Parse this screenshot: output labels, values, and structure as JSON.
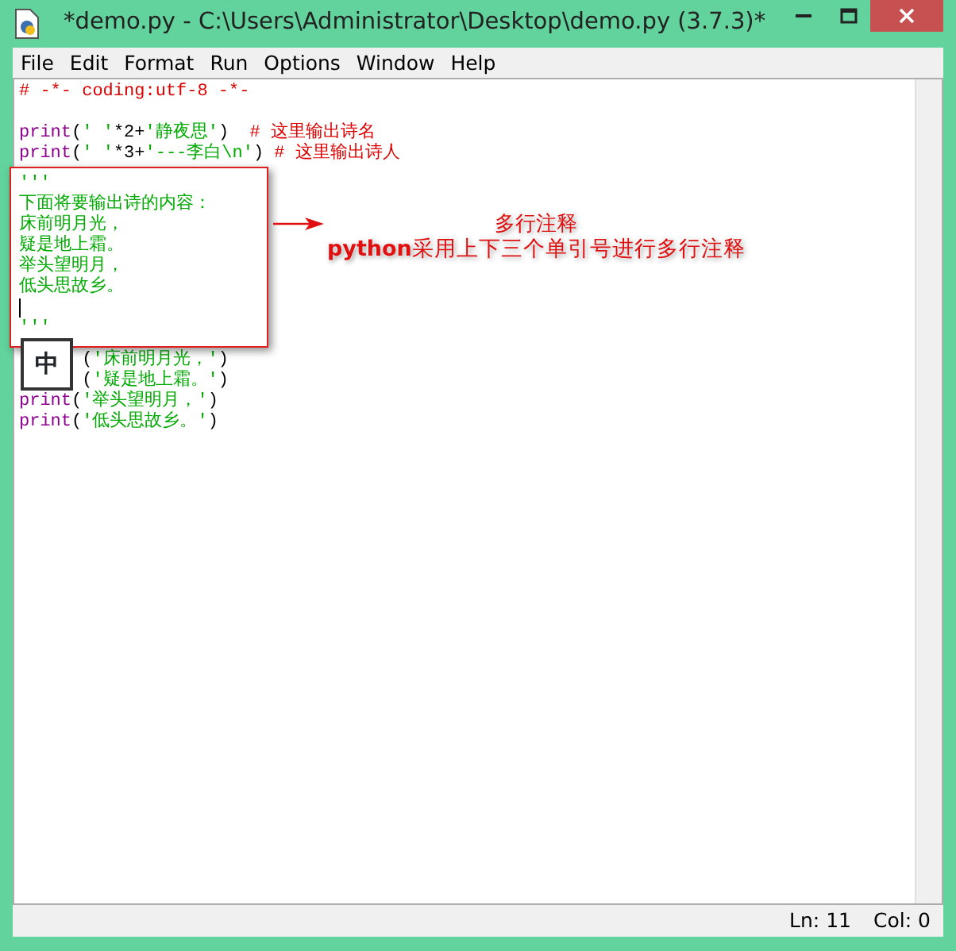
{
  "window": {
    "title": "*demo.py - C:\\Users\\Administrator\\Desktop\\demo.py (3.7.3)*"
  },
  "menu": [
    "File",
    "Edit",
    "Format",
    "Run",
    "Options",
    "Window",
    "Help"
  ],
  "code_lines": [
    {
      "segments": [
        {
          "kind": "comment",
          "text": "# -*- coding:utf-8 -*-"
        }
      ]
    },
    {
      "segments": [
        {
          "kind": "keyword",
          "text": "print"
        },
        {
          "kind": "plain",
          "text": "("
        },
        {
          "kind": "string",
          "text": "' '"
        },
        {
          "kind": "plain",
          "text": "*2+"
        },
        {
          "kind": "string",
          "text": "'静夜思'"
        },
        {
          "kind": "plain",
          "text": ")  "
        },
        {
          "kind": "comment",
          "text": "# 这里输出诗名"
        }
      ]
    },
    {
      "segments": [
        {
          "kind": "keyword",
          "text": "print"
        },
        {
          "kind": "plain",
          "text": "("
        },
        {
          "kind": "string",
          "text": "' '"
        },
        {
          "kind": "plain",
          "text": "*3+"
        },
        {
          "kind": "string",
          "text": "'---李白\\n'"
        },
        {
          "kind": "plain",
          "text": ") "
        },
        {
          "kind": "comment",
          "text": "# 这里输出诗人"
        }
      ]
    }
  ],
  "callout": {
    "lines": [
      {
        "kind": "text",
        "text": "'''"
      },
      {
        "kind": "text",
        "text": "下面将要输出诗的内容："
      },
      {
        "kind": "text",
        "text": "床前明月光，"
      },
      {
        "kind": "text",
        "text": "疑是地上霜。"
      },
      {
        "kind": "text",
        "text": "举头望明月，"
      },
      {
        "kind": "text",
        "text": "低头思故乡。"
      },
      {
        "kind": "cursor"
      },
      {
        "kind": "text",
        "text": "'''"
      }
    ]
  },
  "code_lines_after": [
    {
      "covered": true,
      "segments": [
        {
          "kind": "plain",
          "text": "("
        },
        {
          "kind": "string",
          "text": "'床前明月光，'"
        },
        {
          "kind": "plain",
          "text": ")"
        }
      ]
    },
    {
      "covered": true,
      "segments": [
        {
          "kind": "plain",
          "text": "("
        },
        {
          "kind": "string",
          "text": "'疑是地上霜。'"
        },
        {
          "kind": "plain",
          "text": ")"
        }
      ]
    },
    {
      "covered": false,
      "segments": [
        {
          "kind": "keyword",
          "text": "print"
        },
        {
          "kind": "plain",
          "text": "("
        },
        {
          "kind": "string",
          "text": "'举头望明月，'"
        },
        {
          "kind": "plain",
          "text": ")"
        }
      ]
    },
    {
      "covered": false,
      "segments": [
        {
          "kind": "keyword",
          "text": "print"
        },
        {
          "kind": "plain",
          "text": "("
        },
        {
          "kind": "string",
          "text": "'低头思故乡。'"
        },
        {
          "kind": "plain",
          "text": ")"
        }
      ]
    }
  ],
  "ime_indicator": "中",
  "annotation": {
    "title": "多行注释",
    "text": "**python**采用上下三个单引号进行多行注释"
  },
  "status_bar": {
    "line": "Ln: 11",
    "column": "Col: 0"
  }
}
